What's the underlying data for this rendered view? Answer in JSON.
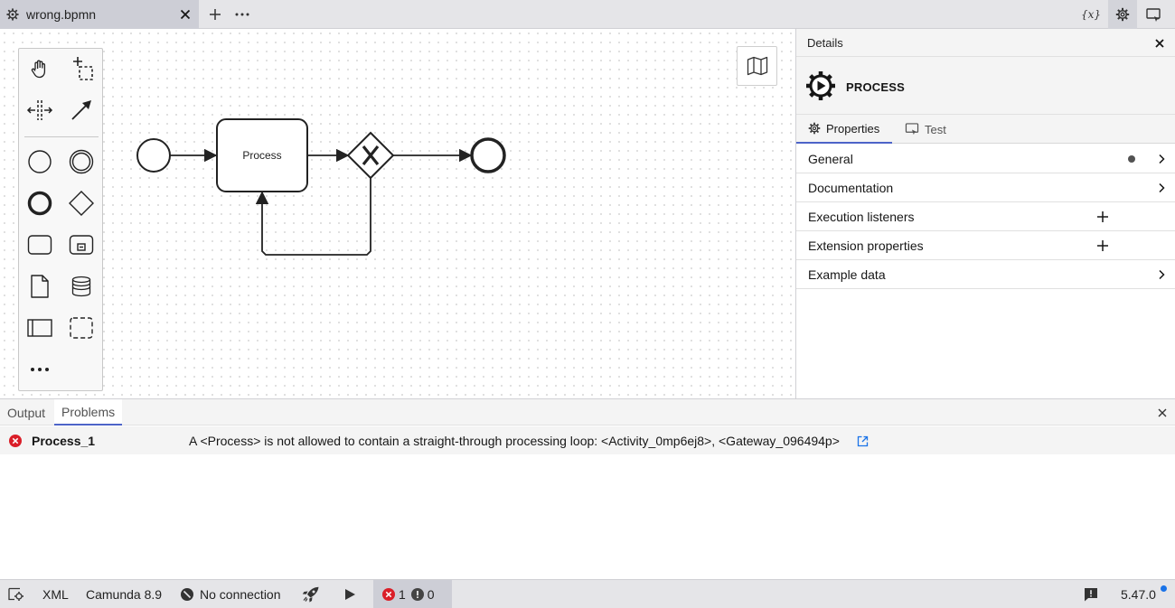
{
  "window": {
    "tab_title": "wrong.bpmn",
    "vars_label": "{x}"
  },
  "diagram": {
    "task_label": "Process",
    "gateway_mark": "X"
  },
  "panel": {
    "title": "Details",
    "entity_type": "PROCESS",
    "tabs": [
      {
        "label": "Properties",
        "active": true
      },
      {
        "label": "Test",
        "active": false
      }
    ],
    "groups": [
      {
        "label": "General",
        "action": "chevron",
        "has_dot": true
      },
      {
        "label": "Documentation",
        "action": "chevron"
      },
      {
        "label": "Execution listeners",
        "action": "plus"
      },
      {
        "label": "Extension properties",
        "action": "plus"
      },
      {
        "label": "Example data",
        "action": "chevron"
      }
    ]
  },
  "bottom": {
    "tabs": [
      {
        "label": "Output",
        "active": false
      },
      {
        "label": "Problems",
        "active": true
      }
    ],
    "problems": [
      {
        "severity": "error",
        "id": "Process_1",
        "message": "A <Process> is not allowed to contain a straight-through processing loop: <Activity_0mp6ej8>, <Gateway_096494p>"
      }
    ]
  },
  "status": {
    "xml": "XML",
    "engine": "Camunda 8.9",
    "connection": "No connection",
    "errors": "1",
    "warnings": "0",
    "version": "5.47.0"
  },
  "colors": {
    "accent": "#4d64c8",
    "error": "#da1e28",
    "update_dot": "#1a73e8"
  }
}
